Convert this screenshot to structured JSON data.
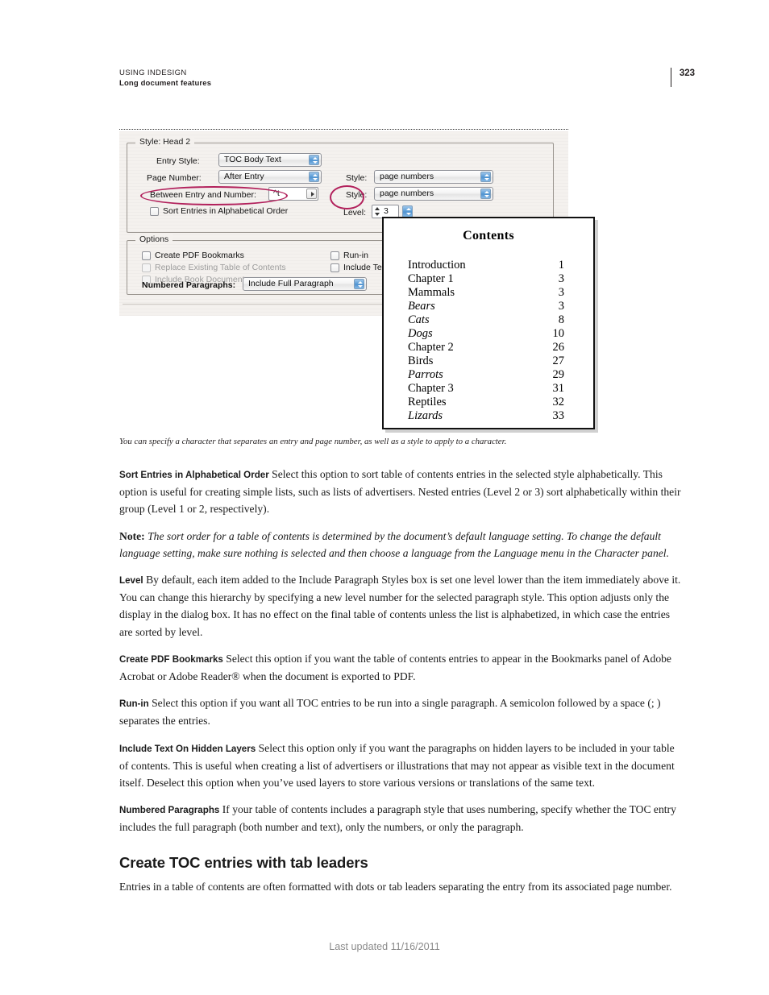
{
  "header": {
    "product": "USING INDESIGN",
    "section": "Long document features",
    "page_number": "323"
  },
  "figure": {
    "dialog": {
      "style_group_label": "Style: Head 2",
      "fields": [
        {
          "label": "Entry Style:",
          "value": "TOC Body Text"
        },
        {
          "label": "Page Number:",
          "value": "After Entry"
        },
        {
          "label": "Between Entry and Number:",
          "value": "^t"
        }
      ],
      "right_fields": [
        {
          "label": "Style:",
          "value": "page numbers"
        },
        {
          "label": "Style:",
          "value": "page numbers"
        }
      ],
      "sort_checkbox_label": "Sort Entries in Alphabetical Order",
      "level_label": "Level:",
      "level_value": "3",
      "options_group_label": "Options",
      "options_checkboxes": [
        {
          "label": "Create PDF Bookmarks",
          "disabled": false
        },
        {
          "label": "Replace Existing Table of Contents",
          "disabled": true
        },
        {
          "label": "Include Book Documents",
          "disabled": true
        },
        {
          "label": "Run-in",
          "disabled": false
        },
        {
          "label": "Include Tex",
          "disabled": false
        }
      ],
      "numbered_paragraphs_label": "Numbered Paragraphs:",
      "numbered_paragraphs_value": "Include Full Paragraph",
      "annotation_color": "#b2215c"
    },
    "toc_panel": {
      "title": "Contents",
      "entries": [
        {
          "name": "Introduction",
          "page": "1",
          "italic": false
        },
        {
          "name": "Chapter 1",
          "page": "3",
          "italic": false
        },
        {
          "name": "Mammals",
          "page": "3",
          "italic": false
        },
        {
          "name": "Bears",
          "page": "3",
          "italic": true
        },
        {
          "name": "Cats",
          "page": "8",
          "italic": true
        },
        {
          "name": "Dogs",
          "page": "10",
          "italic": true
        },
        {
          "name": "Chapter 2",
          "page": "26",
          "italic": false
        },
        {
          "name": "Birds",
          "page": "27",
          "italic": false
        },
        {
          "name": "Parrots",
          "page": "29",
          "italic": true
        },
        {
          "name": "Chapter 3",
          "page": "31",
          "italic": false
        },
        {
          "name": "Reptiles",
          "page": "32",
          "italic": false
        },
        {
          "name": "Lizards",
          "page": "33",
          "italic": true
        }
      ]
    },
    "caption": "You can specify a character that separates an entry and page number, as well as a style to apply to a character."
  },
  "body": {
    "paragraphs": [
      {
        "lead": "Sort Entries in Alphabetical Order",
        "text": "Select this option to sort table of contents entries in the selected style alphabetically. This option is useful for creating simple lists, such as lists of advertisers. Nested entries (Level 2 or 3) sort alphabetically within their group (Level 1 or 2, respectively)."
      },
      {
        "lead": "Note:",
        "text": "The sort order for a table of contents is determined by the document’s default language setting. To change the default language setting, make sure nothing is selected and then choose a language from the Language menu in the Character panel.",
        "style": "note"
      },
      {
        "lead": "Level",
        "text": "By default, each item added to the Include Paragraph Styles box is set one level lower than the item immediately above it. You can change this hierarchy by specifying a new level number for the selected paragraph style. This option adjusts only the display in the dialog box. It has no effect on the final table of contents unless the list is alphabetized, in which case the entries are sorted by level."
      },
      {
        "lead": "Create PDF Bookmarks",
        "text": "Select this option if you want the table of contents entries to appear in the Bookmarks panel of Adobe Acrobat or Adobe Reader® when the document is exported to PDF."
      },
      {
        "lead": "Run-in",
        "text": "Select this option if you want all TOC entries to be run into a single paragraph. A semicolon followed by a space (; ) separates the entries."
      },
      {
        "lead": "Include Text On Hidden Layers",
        "text": "Select this option only if you want the paragraphs on hidden layers to be included in your table of contents. This is useful when creating a list of advertisers or illustrations that may not appear as visible text in the document itself. Deselect this option when you’ve used layers to store various versions or translations of the same text."
      },
      {
        "lead": "Numbered Paragraphs",
        "text": "If your table of contents includes a paragraph style that uses numbering, specify whether the TOC entry includes the full paragraph (both number and text), only the numbers, or only the paragraph."
      }
    ],
    "section_heading": "Create TOC entries with tab leaders",
    "section_paragraph": "Entries in a table of contents are often formatted with dots or tab leaders separating the entry from its associated page number."
  },
  "footer": {
    "text": "Last updated 11/16/2011"
  }
}
